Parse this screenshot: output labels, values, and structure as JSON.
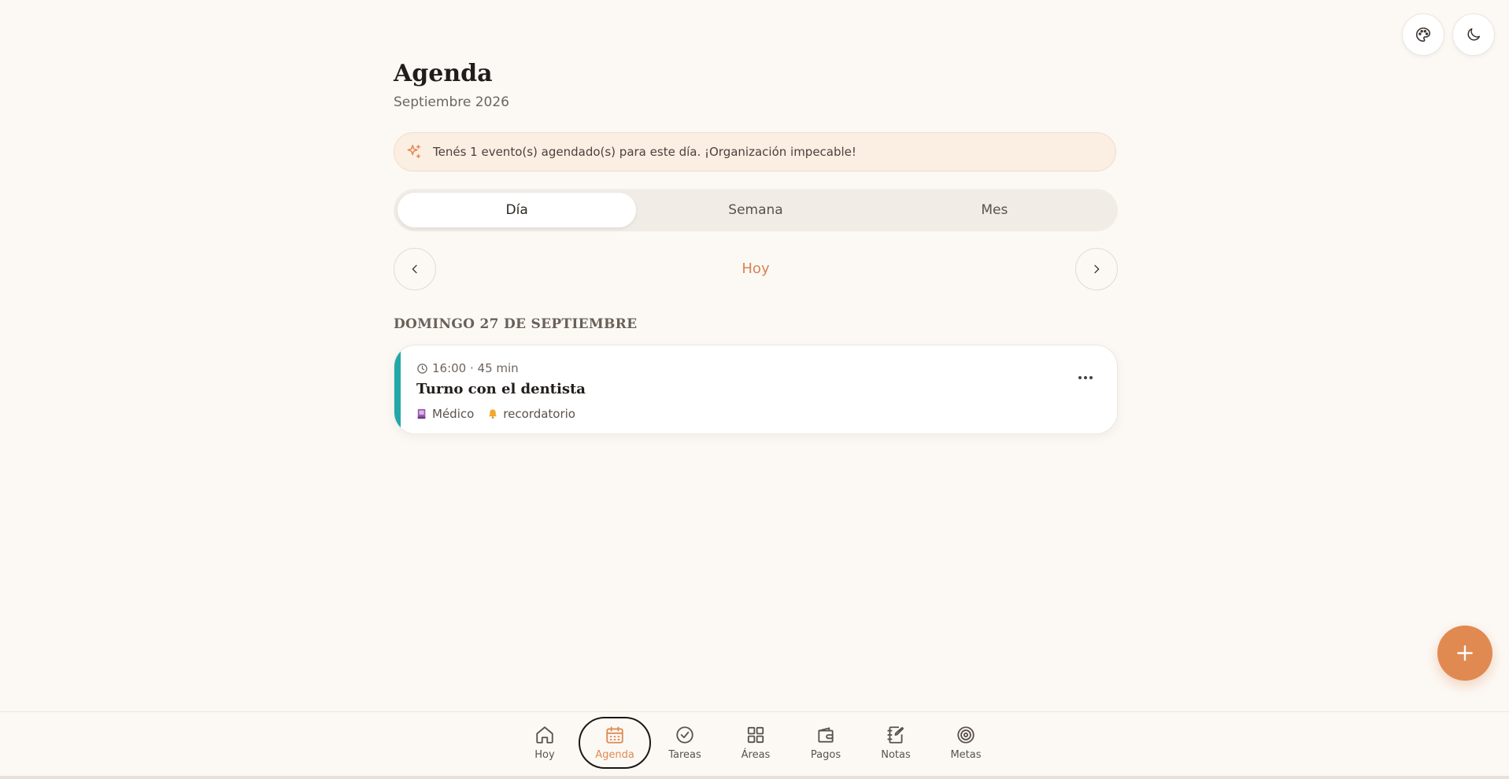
{
  "header": {
    "theme_icon": "palette-icon",
    "dark_mode_icon": "moon-icon"
  },
  "page": {
    "title": "Agenda",
    "subtitle": "Septiembre 2026"
  },
  "banner": {
    "icon": "sparkles-icon",
    "text": "Tenés 1 evento(s) agendado(s) para este día. ¡Organización impecable!"
  },
  "view_switch": {
    "options": [
      "Día",
      "Semana",
      "Mes"
    ],
    "selected": "Día"
  },
  "date_nav": {
    "today_label": "Hoy",
    "prev_icon": "chevron-left-icon",
    "next_icon": "chevron-right-icon"
  },
  "day": {
    "heading": "DOMINGO 27 DE SEPTIEMBRE",
    "events": [
      {
        "time": "16:00 · 45 min",
        "title": "Turno con el dentista",
        "color": "#22a7a7",
        "tags": [
          {
            "label": "Médico",
            "icon": "book-icon"
          },
          {
            "label": "recordatorio",
            "icon": "bell-icon"
          }
        ]
      }
    ]
  },
  "fab": {
    "icon": "plus-icon"
  },
  "bottom_nav": {
    "items": [
      {
        "label": "Hoy",
        "icon": "home-icon"
      },
      {
        "label": "Agenda",
        "icon": "calendar-icon"
      },
      {
        "label": "Tareas",
        "icon": "check-circle-icon"
      },
      {
        "label": "Áreas",
        "icon": "grid-icon"
      },
      {
        "label": "Pagos",
        "icon": "wallet-icon"
      },
      {
        "label": "Notas",
        "icon": "notebook-icon"
      },
      {
        "label": "Metas",
        "icon": "target-icon"
      }
    ],
    "active": "Agenda"
  },
  "colors": {
    "accent": "#e08a52",
    "background": "#fcf9f5",
    "event_stripe": "#22a7a7"
  }
}
